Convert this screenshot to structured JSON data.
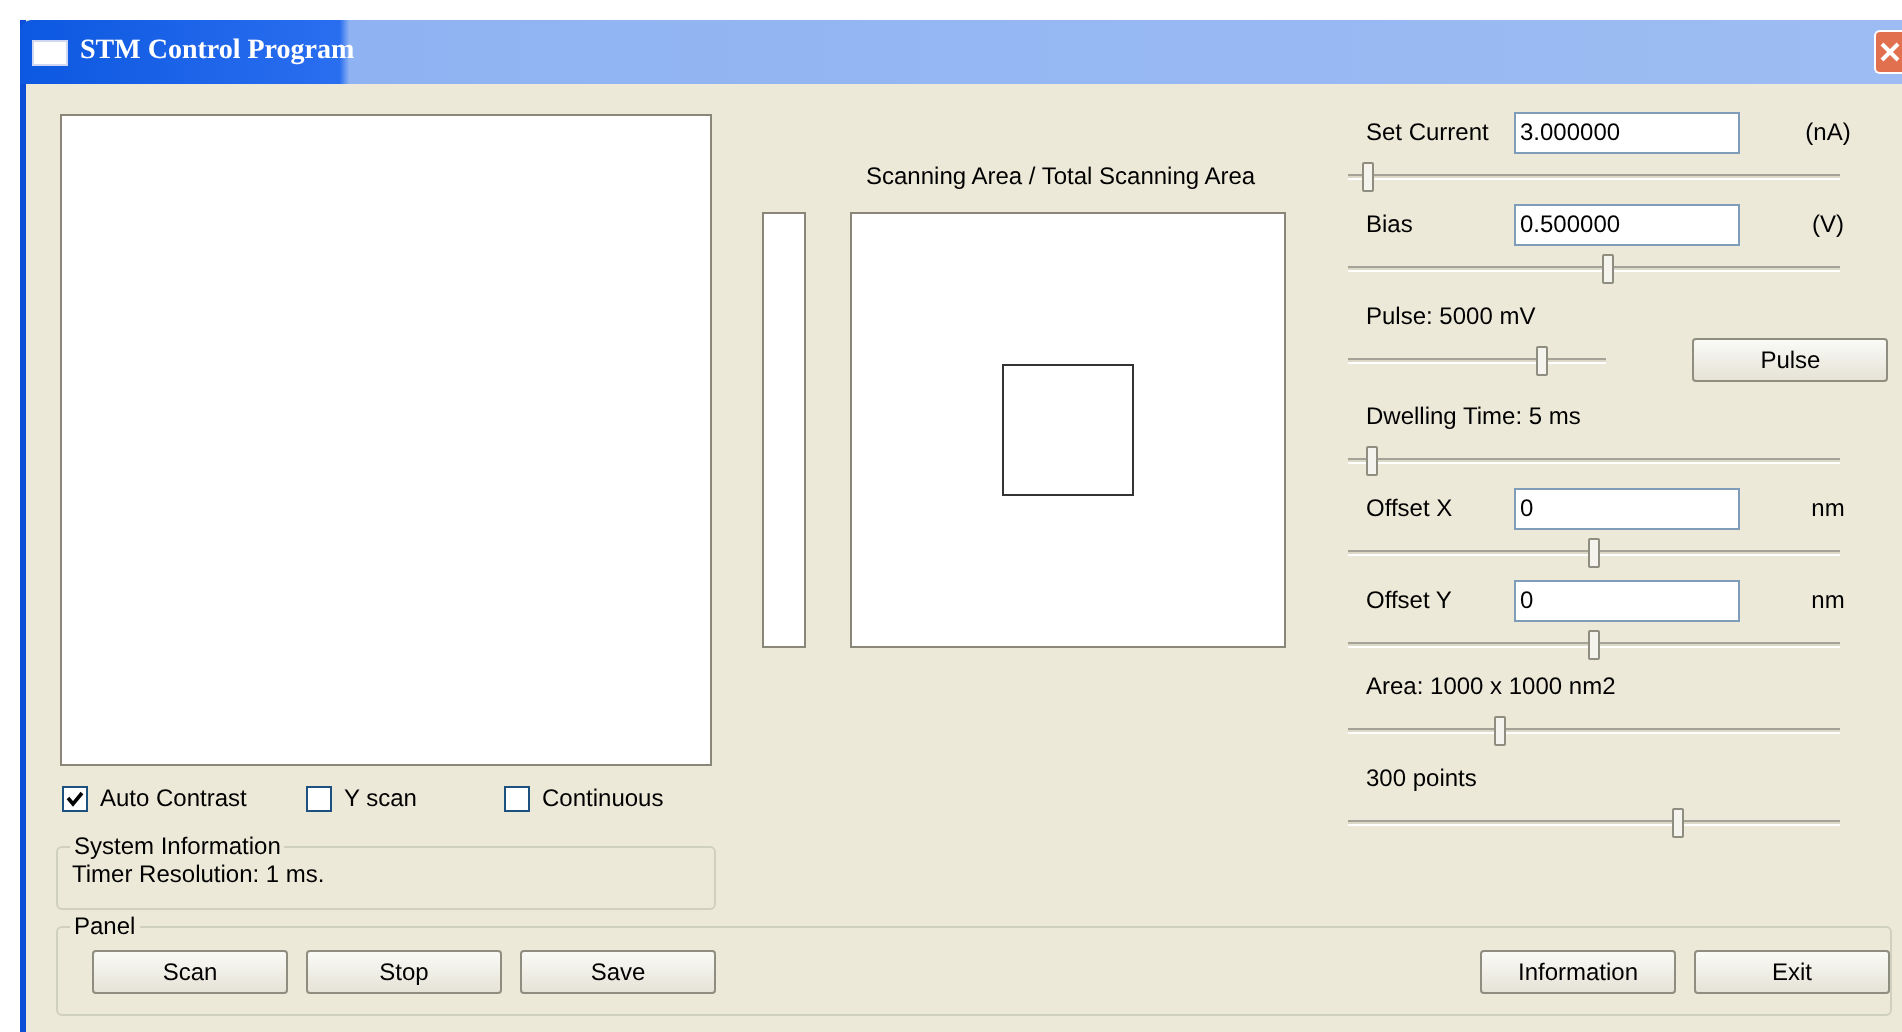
{
  "window": {
    "title": "STM Control Program"
  },
  "image_options": [
    {
      "label": "Auto Contrast",
      "checked": true
    },
    {
      "label": "Y scan",
      "checked": false
    },
    {
      "label": "Continuous",
      "checked": false
    }
  ],
  "system_information": {
    "title": "System Information",
    "text": "Timer Resolution: 1 ms."
  },
  "scan_view": {
    "title": "Scanning Area / Total Scanning Area"
  },
  "controls": [
    {
      "kind": "field",
      "label": "Set Current",
      "value": "3.000000",
      "unit": "(nA)",
      "level": 0.04
    },
    {
      "kind": "field",
      "label": "Bias",
      "value": "0.500000",
      "unit": "(V)",
      "level": 0.53
    },
    {
      "kind": "caption",
      "label": "Pulse: 5000 mV",
      "button": "Pulse",
      "level": 0.75
    },
    {
      "kind": "caption",
      "label": "Dwelling Time: 5 ms",
      "level": 0.05
    },
    {
      "kind": "field",
      "label": "Offset X",
      "value": "0",
      "unit": "nm",
      "level": 0.5
    },
    {
      "kind": "field",
      "label": "Offset Y",
      "value": "0",
      "unit": "nm",
      "level": 0.5
    },
    {
      "kind": "caption",
      "label": "Area: 1000 x 1000 nm2",
      "level": 0.31
    },
    {
      "kind": "caption",
      "label": "300 points",
      "level": 0.67
    }
  ],
  "panel": {
    "title": "Panel",
    "left_buttons": [
      "Scan",
      "Stop",
      "Save"
    ],
    "right_buttons": [
      "Information",
      "Exit"
    ]
  }
}
